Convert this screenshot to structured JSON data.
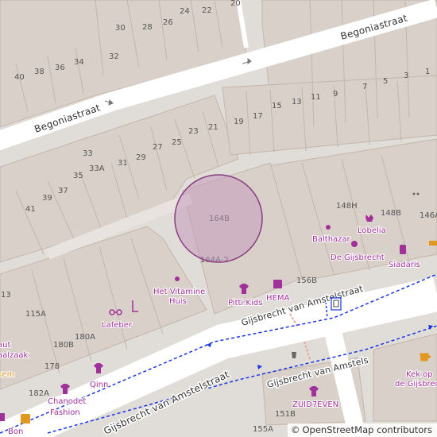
{
  "streets": [
    {
      "id": "begonia-1",
      "label": "Begoniastraat"
    },
    {
      "id": "begonia-2",
      "label": "Begoniastraat"
    },
    {
      "id": "gijsbrecht-1",
      "label": "Gijsbrecht van Amstelstraat"
    },
    {
      "id": "gijsbrecht-2",
      "label": "Gijsbrecht van Amstelstraat"
    },
    {
      "id": "gijsbrecht-3",
      "label": "Gijsbrecht van Amstels"
    }
  ],
  "house_numbers": [
    "20",
    "24",
    "22",
    "30",
    "28",
    "26",
    "32",
    "40",
    "38",
    "36",
    "34",
    "7",
    "5",
    "3",
    "1",
    "19",
    "17",
    "15",
    "13",
    "11",
    "9",
    "23",
    "21",
    "27",
    "25",
    "31",
    "29",
    "33",
    "33A",
    "35",
    "39",
    "37",
    "41",
    "164B",
    "164A-2",
    "156B",
    "148H",
    "148B",
    "146A",
    "13",
    "115A",
    "180A",
    "180B",
    "178",
    "182A",
    "151B",
    "155A"
  ],
  "pois": [
    {
      "id": "het-vitamine-huis",
      "label": "Het Vitamine Huis",
      "icon": "dot"
    },
    {
      "id": "lafeber",
      "label": "Lafeber",
      "icon": "glasses"
    },
    {
      "id": "pitti-kids",
      "label": "Pitti Kids",
      "icon": "shirt"
    },
    {
      "id": "hema",
      "label": "HEMA",
      "icon": "shop"
    },
    {
      "id": "balthazar",
      "label": "Balthazar",
      "icon": "dot"
    },
    {
      "id": "lobelia",
      "label": "Lobelia",
      "icon": "flower"
    },
    {
      "id": "de-gijsbrecht",
      "label": "De Gijsbrecht",
      "icon": "apple"
    },
    {
      "id": "siadaris",
      "label": "Siadaris",
      "icon": "bottle"
    },
    {
      "id": "qinn",
      "label": "Qinn",
      "icon": "shirt"
    },
    {
      "id": "chanodet",
      "label": "Chanodet Fashion",
      "label_line1": "Chanodet",
      "label_line2": "Fashion",
      "icon": "shirt"
    },
    {
      "id": "zuid7even",
      "label": "ZUID7EVEN",
      "icon": "shirt"
    },
    {
      "id": "kek",
      "label": "Kek op de Gijsbrecht",
      "label_line1": "Kek op",
      "label_line2": "de Gijsbrecht",
      "icon": "cup"
    },
    {
      "id": "bon",
      "label": "Bon",
      "icon": "cup"
    },
    {
      "id": "aut",
      "label": "aut",
      "icon": "none"
    },
    {
      "id": "aalzaak",
      "label": "aalzaak",
      "icon": "none"
    },
    {
      "id": "kem",
      "label": "kem",
      "icon": "none"
    }
  ],
  "attribution": {
    "symbol": "©",
    "text": "OpenStreetMap contributors"
  },
  "colors": {
    "background": "#e0dcd7",
    "building": "#d9d0c9",
    "building_stroke": "#c4b6ab",
    "road": "#ffffff",
    "footway": "#f0a09a",
    "bus_route": "#1a35e6",
    "poi": "#a0309a",
    "marker_fill": "rgba(196,150,190,0.55)",
    "marker_stroke": "#8a3a80"
  }
}
